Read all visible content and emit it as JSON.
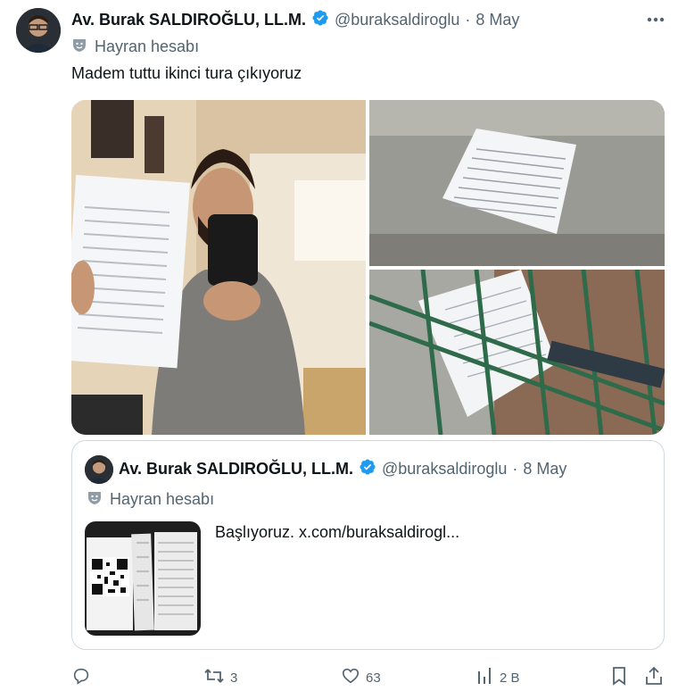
{
  "tweet": {
    "author_name": "Av. Burak SALDIROĞLU, LL.M.",
    "handle": "@buraksaldiroglu",
    "separator": "·",
    "date": "8 May",
    "badge": "Hayran hesabı",
    "text": "Madem tuttu ikinci tura çıkıyoruz"
  },
  "quote": {
    "author_name": "Av. Burak SALDIROĞLU, LL.M.",
    "handle": "@buraksaldiroglu",
    "separator": "·",
    "date": "8 May",
    "badge": "Hayran hesabı",
    "text": "Başlıyoruz.  x.com/buraksaldirogl..."
  },
  "actions": {
    "replies": "",
    "retweets": "3",
    "likes": "63",
    "views": "2 B"
  },
  "colors": {
    "verified": "#1d9bf0",
    "text": "#0f1419",
    "muted": "#536471",
    "border": "#cfd9de"
  },
  "icons": [
    "more-icon",
    "verified-icon",
    "fan-badge-icon",
    "reply-icon",
    "retweet-icon",
    "like-icon",
    "views-icon",
    "bookmark-icon",
    "share-icon"
  ]
}
